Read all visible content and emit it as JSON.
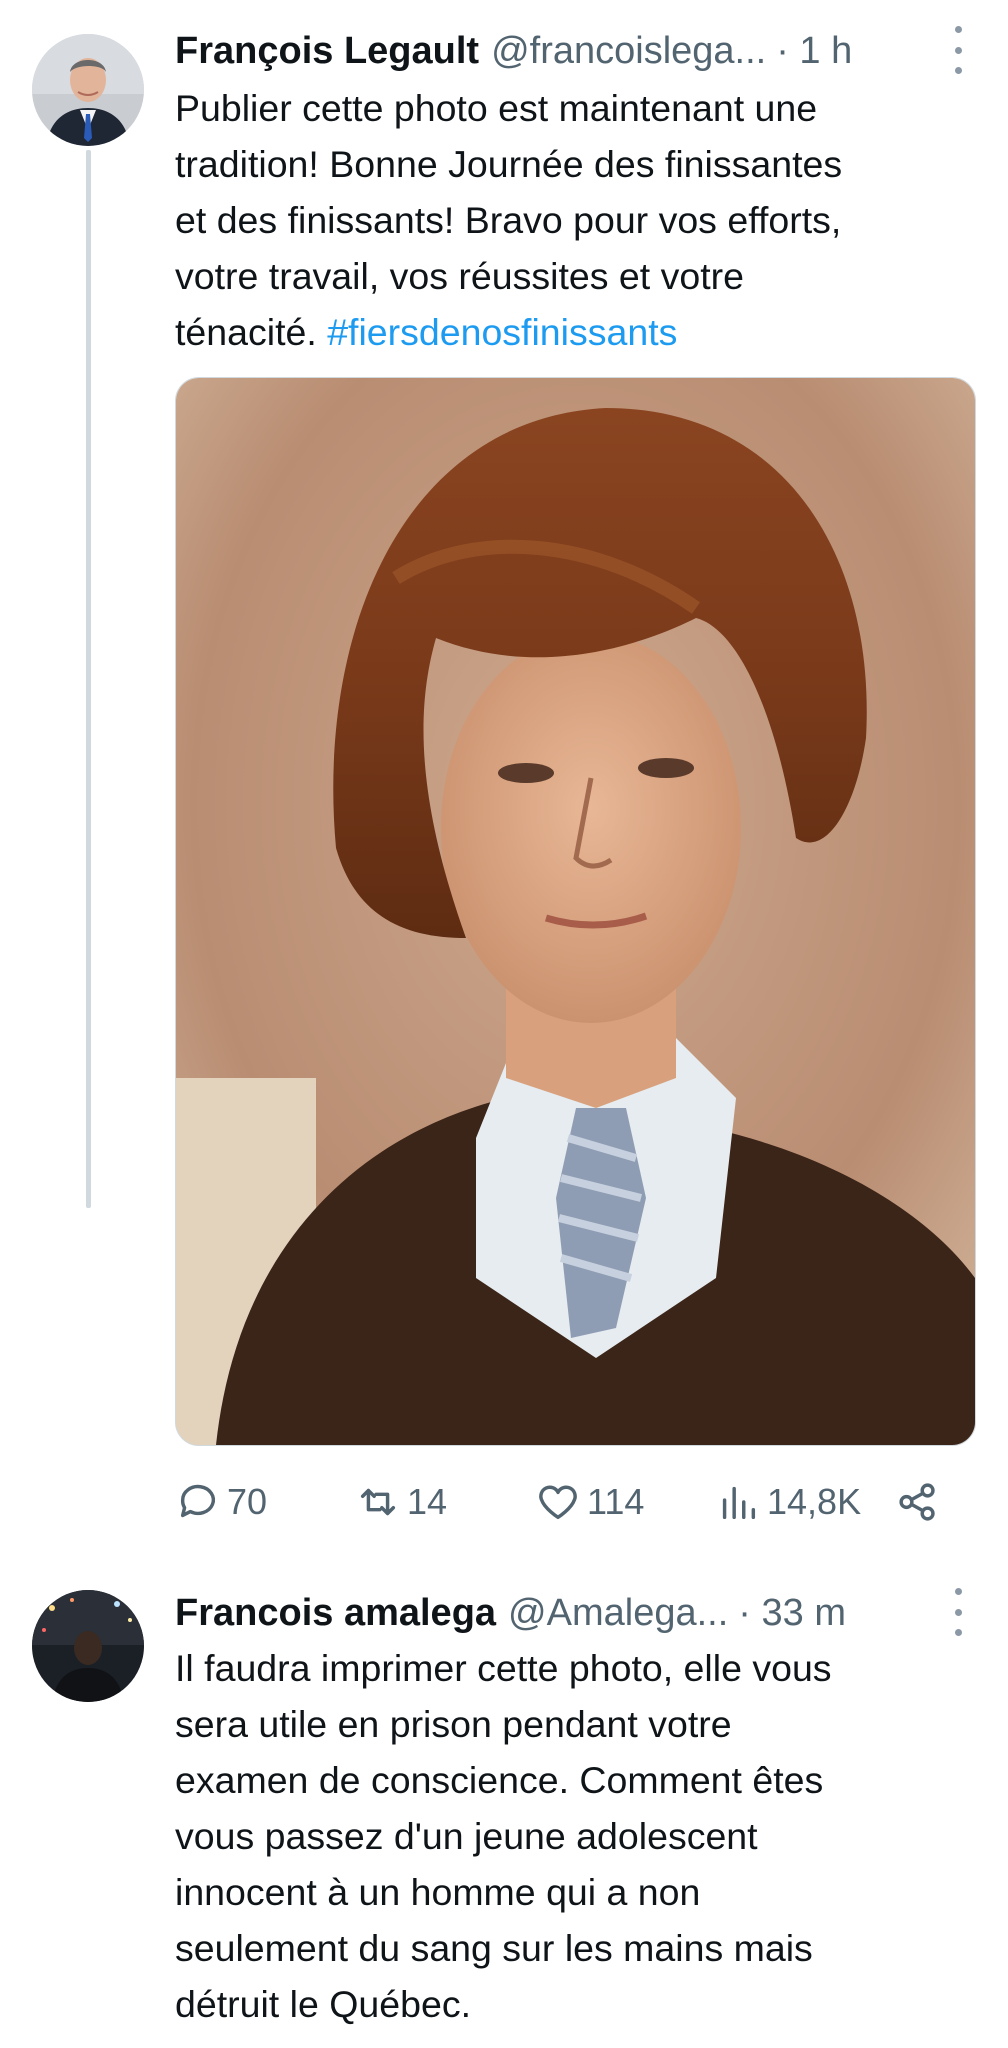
{
  "tweets": [
    {
      "author_name": "François Legault",
      "handle": "@francoislega...",
      "time": "· 1 h",
      "text_main": "Publier cette photo est maintenant une\ntradition! Bonne Journée des finissantes\net des finissants! Bravo pour vos efforts,\nvotre travail, vos réussites et votre\nténacité. ",
      "hashtag": "#fiersdenosfinissants",
      "stats": {
        "replies": "70",
        "retweets": "14",
        "likes": "114",
        "views": "14,8K"
      }
    },
    {
      "author_name": "Francois amalega",
      "handle": "@Amalega...",
      "time": "· 33 m",
      "text_main": "Il faudra imprimer cette photo, elle vous\nsera utile en prison pendant votre\nexamen de conscience. Comment êtes\nvous passez d'un jeune adolescent\ninnocent à un homme qui a non\nseulement du sang sur les mains mais\ndétruit le Québec."
    }
  ],
  "icons": {
    "reply": "reply-icon",
    "retweet": "retweet-icon",
    "like": "heart-icon",
    "views": "views-icon",
    "share": "share-icon",
    "more": "more-options-icon"
  },
  "colors": {
    "hashtag": "#1d9bf0",
    "secondary_text": "#536471",
    "thread_line": "#cfd9de"
  }
}
